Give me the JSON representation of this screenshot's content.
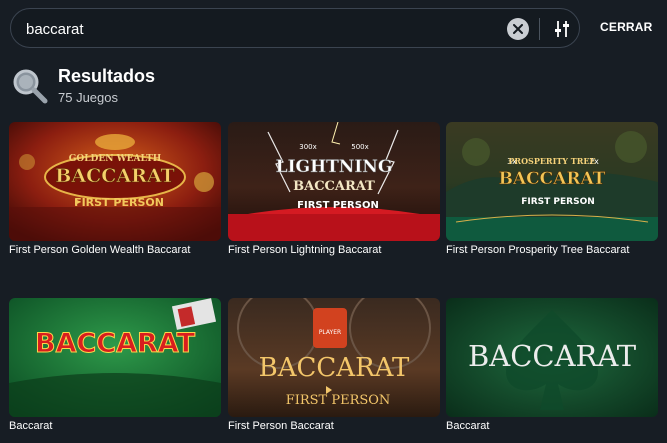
{
  "search": {
    "value": "baccarat",
    "close_label": "CERRAR"
  },
  "results": {
    "title": "Resultados",
    "count": "75 Juegos"
  },
  "games": [
    {
      "title": "First Person Golden Wealth Baccarat",
      "art_top": "GOLDEN WEALTH",
      "art_main": "BACCARAT",
      "art_sub": "FIRST PERSON"
    },
    {
      "title": "First Person Lightning Baccarat",
      "art_top": "LIGHTNING",
      "art_main": "BACCARAT",
      "art_sub": "FIRST PERSON",
      "art_mult1": "300x",
      "art_mult2": "500x"
    },
    {
      "title": "First Person Prosperity Tree Baccarat",
      "art_top": "PROSPERITY TREE",
      "art_main": "BACCARAT",
      "art_sub": "FIRST PERSON",
      "art_mult1": "3x",
      "art_mult2": "2x"
    },
    {
      "title": "Baccarat",
      "art_main": "BACCARAT"
    },
    {
      "title": "First Person Baccarat",
      "art_main": "BACCARAT",
      "art_sub": "FIRST PERSON",
      "art_chip": "PLAYER"
    },
    {
      "title": "Baccarat",
      "art_main": "BACCARAT"
    }
  ]
}
